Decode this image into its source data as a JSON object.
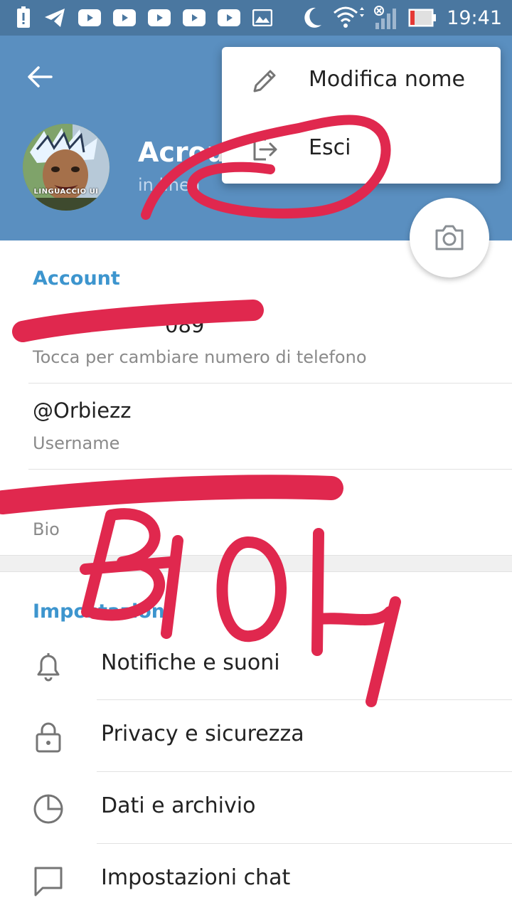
{
  "status_bar": {
    "time": "19:41",
    "icons": [
      "battery-alert-icon",
      "telegram-icon",
      "youtube-icon",
      "youtube-icon",
      "youtube-icon",
      "youtube-icon",
      "youtube-icon",
      "gallery-icon",
      "moon-icon",
      "wifi-icon",
      "signal-icon",
      "battery-icon"
    ]
  },
  "header": {
    "profile_name": "Acrou",
    "profile_status": "in linea",
    "avatar_caption": "LINGUACCIO UI"
  },
  "popup_menu": {
    "items": [
      {
        "label": "Modifica nome",
        "icon": "pencil-icon"
      },
      {
        "label": "Esci",
        "icon": "logout-icon"
      }
    ]
  },
  "account": {
    "title": "Account",
    "phone_value": "089",
    "phone_hint": "Tocca per cambiare numero di telefono",
    "username_value": "@Orbiezz",
    "username_hint": "Username",
    "bio_hint": "Bio"
  },
  "settings": {
    "title": "Impostazioni",
    "items": [
      {
        "label": "Notifiche e suoni",
        "icon": "bell-icon"
      },
      {
        "label": "Privacy e sicurezza",
        "icon": "lock-icon"
      },
      {
        "label": "Dati e archivio",
        "icon": "clock-pie-icon"
      },
      {
        "label": "Impostazioni chat",
        "icon": "chat-bubble-icon"
      }
    ]
  },
  "annotation": {
    "text": "BIOH",
    "color": "#e0284e"
  },
  "colors": {
    "status_bar": "#4a77a0",
    "header": "#5a8fc0",
    "accent": "#3d95ce",
    "scribble": "#e0284e"
  }
}
